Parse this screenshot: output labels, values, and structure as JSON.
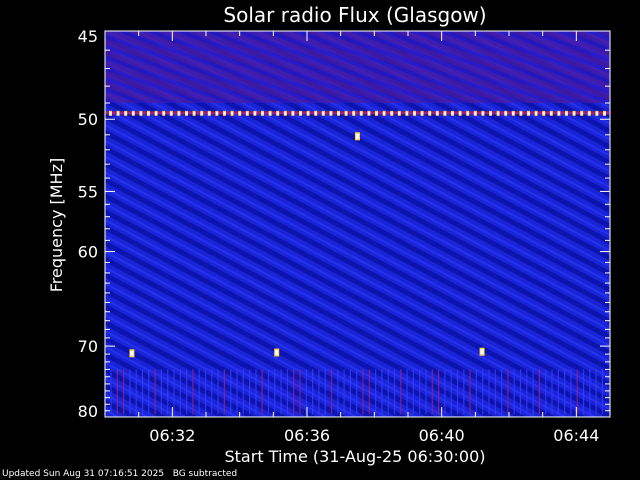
{
  "chart_data": {
    "type": "heatmap",
    "title": "Solar radio Flux (Glasgow)",
    "xlabel": "Start Time (31-Aug-25 06:30:00)",
    "ylabel": "Frequency [MHz]",
    "x_tick_labels": [
      "06:32",
      "06:36",
      "06:40",
      "06:44"
    ],
    "x_tick_minutes": [
      2,
      6,
      10,
      14
    ],
    "xlim_minutes": [
      0,
      15
    ],
    "y_tick_labels": [
      "45",
      "50",
      "55",
      "60",
      "70",
      "80"
    ],
    "y_tick_values": [
      45,
      50,
      55,
      60,
      70,
      80
    ],
    "ylim": [
      45,
      80
    ],
    "y_scale": "reciprocal",
    "colormap": [
      "#000090",
      "#2020ff",
      "#a02080",
      "#ffd040",
      "#ffffff"
    ],
    "background_color": "#1a22d8",
    "features": [
      {
        "kind": "narrowband-line",
        "freq_mhz": 49.6
      },
      {
        "kind": "interference-band",
        "freq_range_mhz": [
          45,
          49
        ]
      },
      {
        "kind": "striated-band",
        "freq_range_mhz": [
          73,
          78
        ]
      },
      {
        "kind": "spot",
        "time_minutes": 7.5,
        "freq_mhz": 51.1
      },
      {
        "kind": "spot",
        "time_minutes": 5.1,
        "freq_mhz": 70.8
      },
      {
        "kind": "spot",
        "time_minutes": 0.8,
        "freq_mhz": 70.9
      },
      {
        "kind": "spot",
        "time_minutes": 11.2,
        "freq_mhz": 70.7
      }
    ]
  },
  "footer": {
    "updated": "Updated Sun Aug 31 07:16:51 2025",
    "bg_note": "BG subtracted"
  }
}
